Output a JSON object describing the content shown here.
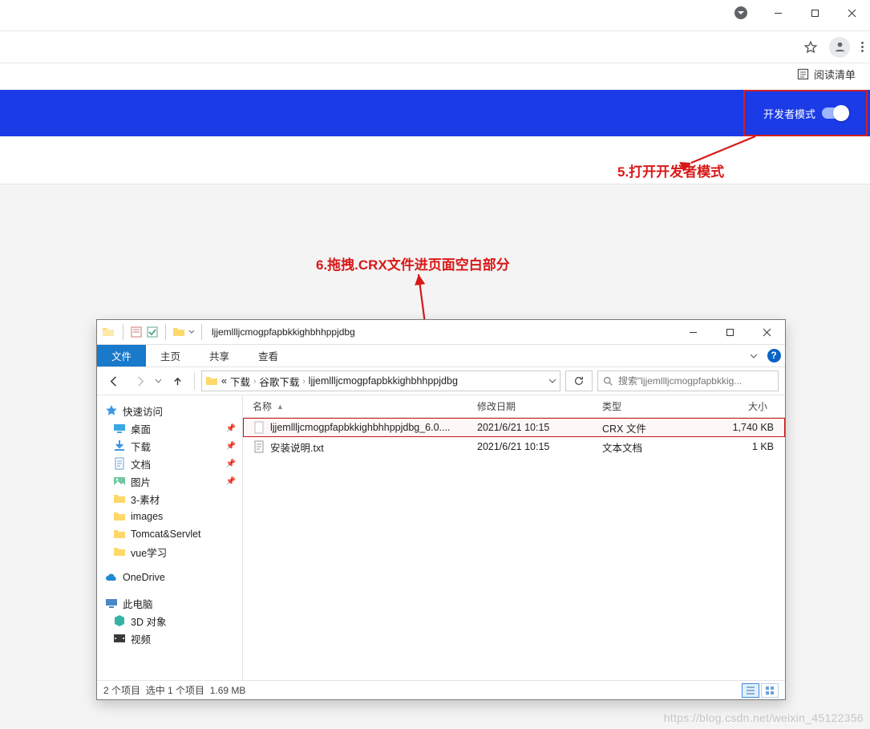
{
  "win_buttons": {
    "minimize": "—",
    "maximize": "□",
    "close": "✕"
  },
  "reading_list": "阅读清单",
  "dev_mode_label": "开发者模式",
  "annotation5": "5.打开开发者模式",
  "annotation6": "6.拖拽.CRX文件进页面空白部分",
  "drag_label": "拖拽",
  "explorer": {
    "title": "ljjemllljcmogpfapbkkighbhhppjdbg",
    "tabs": {
      "file": "文件",
      "home": "主页",
      "share": "共享",
      "view": "查看"
    },
    "breadcrumb": {
      "back": "«",
      "p1": "下载",
      "p2": "谷歌下载",
      "p3": "ljjemllljcmogpfapbkkighbhhppjdbg"
    },
    "search_placeholder": "搜索\"ljjemllljcmogpfapbkkig...",
    "nav": {
      "quick": "快速访问",
      "desktop": "桌面",
      "downloads": "下载",
      "documents": "文档",
      "pictures": "图片",
      "f1": "3-素材",
      "f2": "images",
      "f3": "Tomcat&Servlet",
      "f4": "vue学习",
      "onedrive": "OneDrive",
      "thispc": "此电脑",
      "obj3d": "3D 对象",
      "videos": "视频"
    },
    "columns": {
      "name": "名称",
      "date": "修改日期",
      "type": "类型",
      "size": "大小"
    },
    "rows": [
      {
        "name": "ljjemllljcmogpfapbkkighbhhppjdbg_6.0....",
        "date": "2021/6/21 10:15",
        "type": "CRX 文件",
        "size": "1,740 KB",
        "selected": true,
        "icon": "file"
      },
      {
        "name": "安装说明.txt",
        "date": "2021/6/21 10:15",
        "type": "文本文档",
        "size": "1 KB",
        "selected": false,
        "icon": "txt"
      }
    ],
    "status": {
      "count": "2 个项目",
      "selected": "选中 1 个项目",
      "size": "1.69 MB"
    }
  },
  "watermark": "https://blog.csdn.net/weixin_45122356"
}
